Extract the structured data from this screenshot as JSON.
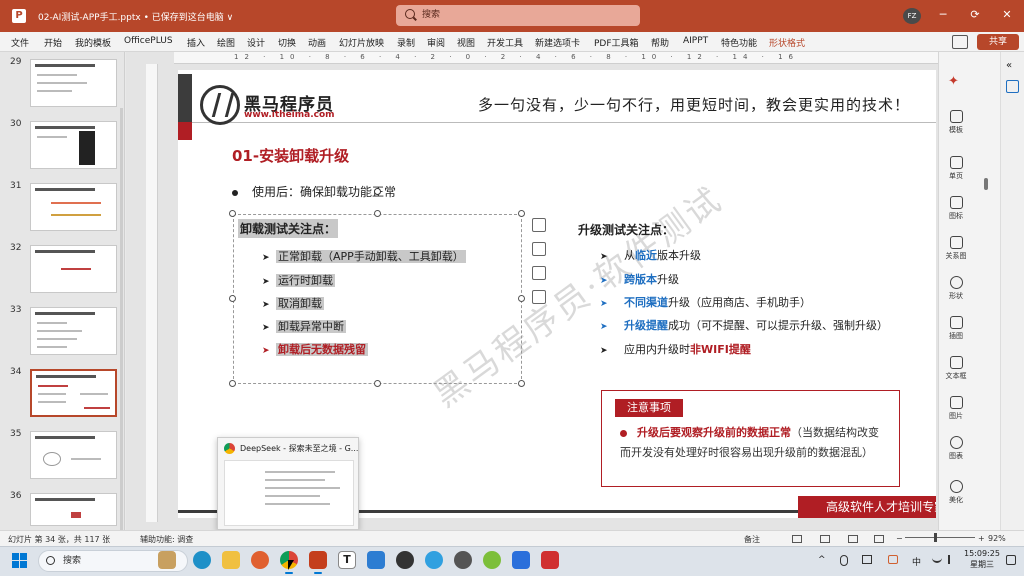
{
  "window": {
    "app_icon": "P",
    "title": "02-AI测试-APP手工.pptx • 已保存到这台电脑 ∨",
    "search_placeholder": "搜索",
    "user_initials": "FZ",
    "controls": [
      "─",
      "▢",
      "⟳",
      "▫",
      "✕"
    ]
  },
  "menu": {
    "items": [
      "文件",
      "开始",
      "我的模板",
      "OfficePLUS",
      "插入",
      "绘图",
      "设计",
      "切换",
      "动画",
      "幻灯片放映",
      "录制",
      "审阅",
      "视图",
      "开发工具",
      "新建选项卡",
      "PDF工具箱",
      "帮助",
      "AIPPT",
      "特色功能"
    ],
    "contextual": "形状格式",
    "share_label": "共享"
  },
  "thumbnails": [
    {
      "number": "29",
      "selected": false
    },
    {
      "number": "30",
      "selected": false
    },
    {
      "number": "31",
      "selected": false
    },
    {
      "number": "32",
      "selected": false
    },
    {
      "number": "33",
      "selected": false
    },
    {
      "number": "34",
      "selected": true
    },
    {
      "number": "35",
      "selected": false
    },
    {
      "number": "36",
      "selected": false
    }
  ],
  "ruler_top_labels": "12 · 10 · 8 · 6 · 4 · 2 · 0 · 2 · 4 · 6 · 8 · 10 · 12 · 14 · 16",
  "slide": {
    "logo_cn": "黑马程序员",
    "logo_en": "www.itheima.com",
    "slogan": "多一句没有，少一句不行，用更短时间，教会更实用的技术！",
    "title": "01-安装卸载升级",
    "main_bullet": "使用后：确保卸载功能正常",
    "left_heading": "卸载测试关注点：",
    "left_items": [
      {
        "text": "正常卸载（APP手动卸载、工具卸载）",
        "red": false
      },
      {
        "text": "运行时卸载",
        "red": false
      },
      {
        "text": "取消卸载",
        "red": false
      },
      {
        "text": "卸载异常中断",
        "red": false
      },
      {
        "text": "卸载后无数据残留",
        "red": true
      }
    ],
    "watermark": "黑马程序员·软件测试",
    "right_heading": "升级测试关注点：",
    "right_items": [
      {
        "pre": "从",
        "hl": "临近",
        "post": "版本升级",
        "hl_color": "blue",
        "arrow": "black"
      },
      {
        "pre": "",
        "hl": "跨版本",
        "post": "升级",
        "hl_color": "blue",
        "arrow": "blue"
      },
      {
        "pre": "",
        "hl": "不同渠道",
        "post": "升级（应用商店、手机助手）",
        "hl_color": "blue",
        "arrow": "blue"
      },
      {
        "pre": "",
        "hl": "升级提醒",
        "post": "成功（可不提醒、可以提示升级、强制升级）",
        "hl_color": "blue",
        "arrow": "blue"
      },
      {
        "pre": "应用内升级时",
        "hl": "非WIFI提醒",
        "post": "",
        "hl_color": "red",
        "arrow": "black"
      }
    ],
    "notice_label": "注意事项",
    "notice_hl": "升级后要观察升级前的数据正常",
    "notice_rest": "（当数据结构改变而开发没有处理好时很容易出现升级前的数据混乱）",
    "footer_text": "高级软件人才培训专家"
  },
  "preview_popup": {
    "title": "DeepSeek - 探索未至之境 - G..."
  },
  "right_panel": [
    {
      "label": "模板",
      "icon": "template-icon"
    },
    {
      "label": "单页",
      "icon": "single-page-icon"
    },
    {
      "label": "图标",
      "icon": "icons-icon"
    },
    {
      "label": "关系图",
      "icon": "relationship-icon"
    },
    {
      "label": "形状",
      "icon": "shape-icon"
    },
    {
      "label": "插图",
      "icon": "illustration-icon"
    },
    {
      "label": "文本框",
      "icon": "textbox-icon"
    },
    {
      "label": "图片",
      "icon": "picture-icon"
    },
    {
      "label": "图表",
      "icon": "chart-icon"
    },
    {
      "label": "美化",
      "icon": "beautify-icon"
    }
  ],
  "status": {
    "slide_info": "幻灯片 第 34 张，共 117 张",
    "accessibility": "辅助功能: 调查",
    "notes": "备注",
    "zoom": "92%"
  },
  "taskbar": {
    "search_placeholder": "搜索",
    "time": "15:09:25",
    "date": "星期三",
    "tray_lang": "中"
  },
  "colors": {
    "brand_red": "#b01e24",
    "title_bar": "#b7472a",
    "highlight_blue": "#1f6fc1"
  }
}
